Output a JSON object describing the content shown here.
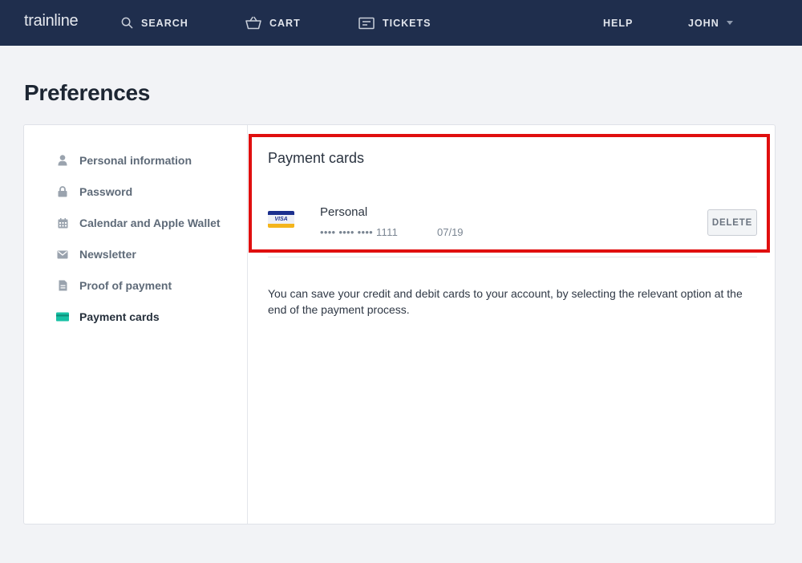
{
  "header": {
    "logo": "trainline",
    "nav": {
      "search": "SEARCH",
      "cart": "CART",
      "tickets": "TICKETS",
      "help": "HELP",
      "user": "JOHN"
    }
  },
  "page": {
    "title": "Preferences"
  },
  "sidebar": {
    "items": [
      {
        "label": "Personal information",
        "icon": "person-icon"
      },
      {
        "label": "Password",
        "icon": "lock-icon"
      },
      {
        "label": "Calendar and Apple Wallet",
        "icon": "calendar-icon"
      },
      {
        "label": "Newsletter",
        "icon": "envelope-icon"
      },
      {
        "label": "Proof of payment",
        "icon": "document-icon"
      },
      {
        "label": "Payment cards",
        "icon": "card-icon",
        "active": true
      }
    ]
  },
  "payment_cards": {
    "title": "Payment cards",
    "card": {
      "brand": "VISA",
      "name": "Personal",
      "number": "•••• •••• •••• 1111",
      "expiry": "07/19",
      "delete_label": "DELETE"
    },
    "info": "You can save your credit and debit cards to your account, by selecting the relevant option at the end of the payment process."
  },
  "colors": {
    "header_bg": "#1f2e4d",
    "page_bg": "#f2f3f6",
    "accent_teal": "#18c1a5",
    "highlight_red": "#e00f0f"
  }
}
